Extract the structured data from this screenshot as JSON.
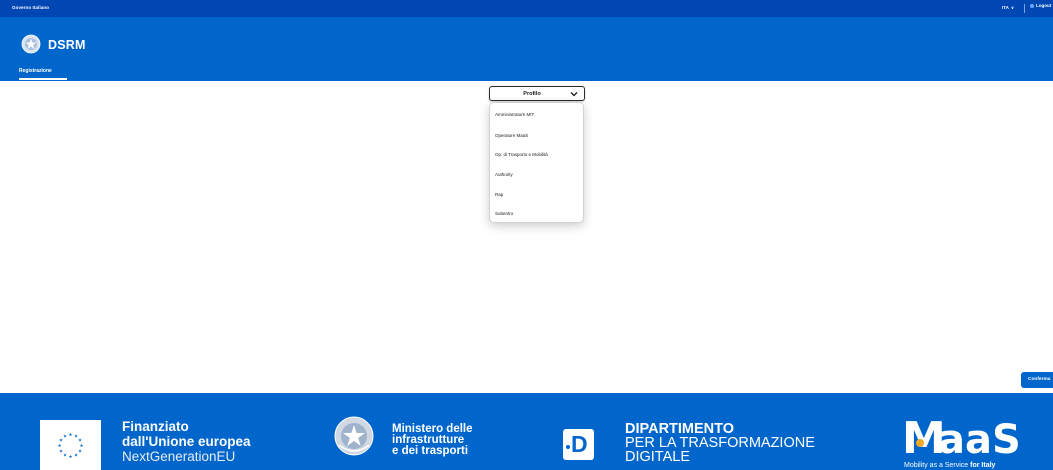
{
  "topbar": {
    "gov_label": "Governo Italiano",
    "language": "ITA",
    "login": "Logout"
  },
  "header": {
    "app_name": "DSRM",
    "nav_tab": "Registrazione"
  },
  "profile_select": {
    "label": "Profilo",
    "options": [
      "Amministratore MIT",
      "Operatore MaaS",
      "Op. di Trasporto e Mobilità",
      "Authority",
      "Rap",
      "Subentro"
    ]
  },
  "confirm_button": "Conferma",
  "footer": {
    "eu": {
      "line1": "Finanziato",
      "line2": "dall'Unione europea",
      "line3": "NextGenerationEU"
    },
    "mit": {
      "line1": "Ministero delle",
      "line2": "infrastrutture",
      "line3": "e dei trasporti"
    },
    "dtd": {
      "line1": "DIPARTIMENTO",
      "line2": "PER LA TRASFORMAZIONE",
      "line3": "DIGITALE"
    },
    "maas": {
      "tagline_plain": "Mobility as a Service ",
      "tagline_bold": "for Italy"
    }
  },
  "colors": {
    "topbar": "#0047b3",
    "primary": "#0066cc",
    "maas_accent": "#f5a623"
  },
  "icons": {
    "emblem": "italian-republic-emblem-icon",
    "select_chevron": "chevron-down-icon",
    "eu_flag": "eu-flag-icon",
    "maas_pin": "map-pin-icon"
  }
}
